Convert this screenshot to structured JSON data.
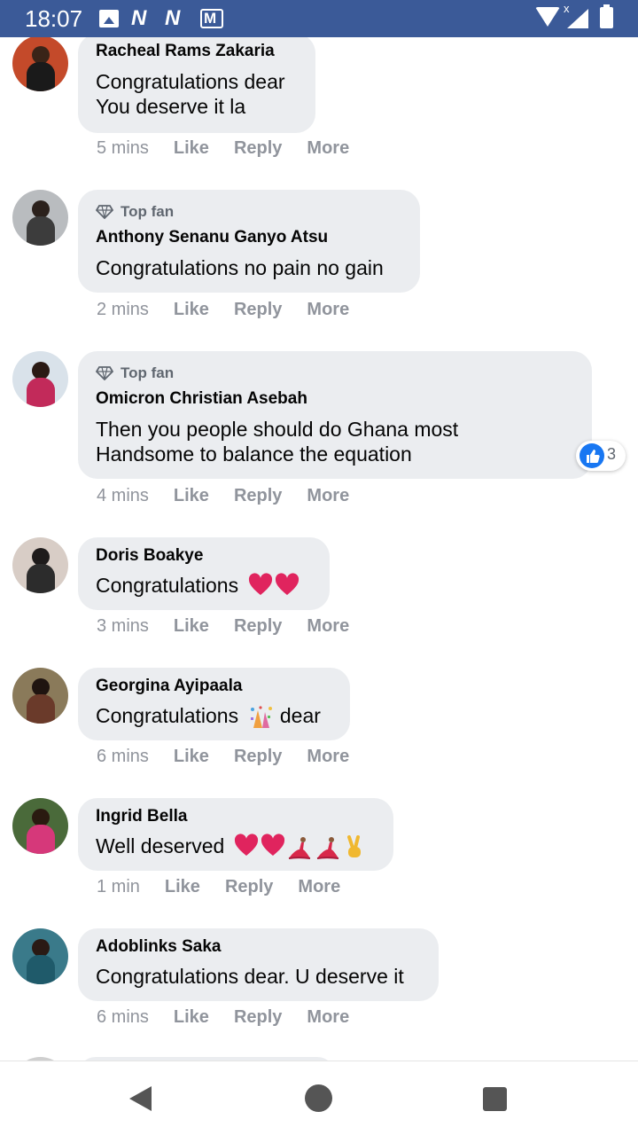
{
  "status_bar": {
    "time": "18:07",
    "notification_icons": [
      "image-icon",
      "n-icon",
      "n-icon",
      "gmail-icon"
    ],
    "n_label": "N",
    "system_icons": [
      "wifi-icon",
      "signal-icon",
      "battery-icon"
    ],
    "signal_x": "x",
    "background": "#3b5a98"
  },
  "comments": [
    {
      "author": "Racheal Rams Zakaria",
      "top_fan": false,
      "lines": [
        "Congratulations dear",
        "You deserve it la"
      ],
      "time": "5 mins"
    },
    {
      "author": "Anthony Senanu Ganyo Atsu",
      "top_fan": true,
      "lines": [
        "Congratulations no pain no gain"
      ],
      "time": "2 mins"
    },
    {
      "author": "Omicron Christian Asebah",
      "top_fan": true,
      "lines": [
        "Then you people should do Ghana most",
        "Handsome to balance the equation"
      ],
      "time": "4 mins",
      "reaction_count": "3"
    },
    {
      "author": "Doris Boakye",
      "top_fan": false,
      "lines": [
        "Congratulations"
      ],
      "emojis": [
        "heart",
        "heart"
      ],
      "time": "3 mins"
    },
    {
      "author": "Georgina Ayipaala",
      "top_fan": false,
      "lines": [
        "Congratulations",
        "dear"
      ],
      "emojis": [
        "confetti"
      ],
      "time": "6 mins"
    },
    {
      "author": "Ingrid Bella",
      "top_fan": false,
      "lines": [
        "Well deserved"
      ],
      "emojis": [
        "heart",
        "heart",
        "dancer",
        "dancer",
        "victory-hand"
      ],
      "time": "1 min"
    },
    {
      "author": "Adoblinks Saka",
      "top_fan": false,
      "lines": [
        "Congratulations dear. U deserve it"
      ],
      "time": "6 mins"
    }
  ],
  "labels": {
    "top_fan": "Top fan",
    "like": "Like",
    "reply": "Reply",
    "more": "More"
  },
  "colors": {
    "bubble": "#ebedf0",
    "meta_text": "#90949c",
    "like_blue": "#1877f2",
    "heart_red": "#e0245e"
  },
  "nav_bar": {
    "buttons": [
      "back-icon",
      "home-icon",
      "recents-icon"
    ]
  }
}
